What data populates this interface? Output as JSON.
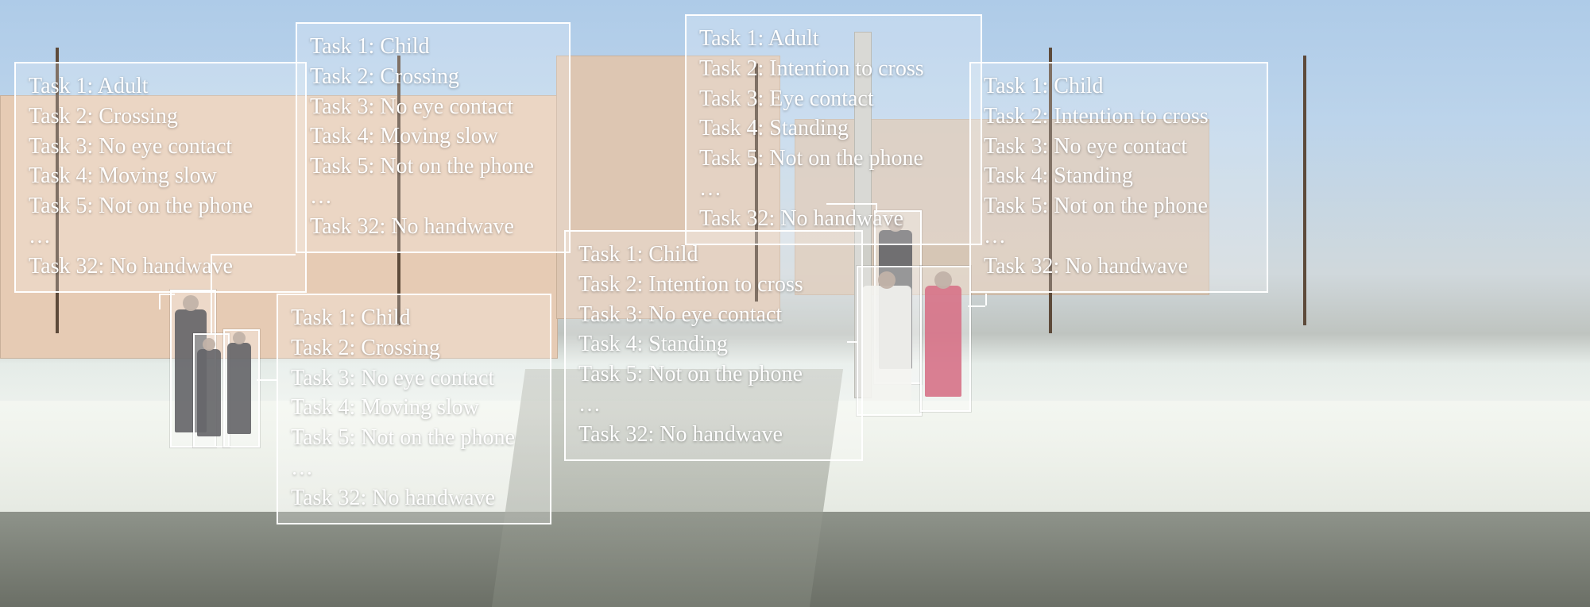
{
  "task_prefix": "Task",
  "ellipsis": "…",
  "panels": {
    "p1": {
      "lines": {
        "t1": "1: Adult",
        "t2": "2: Crossing",
        "t3": "3: No eye contact",
        "t4": "4: Moving slow",
        "t5": "5: Not on the phone",
        "t32": "32: No handwave"
      }
    },
    "p2": {
      "lines": {
        "t1": "1: Child",
        "t2": "2: Crossing",
        "t3": "3: No eye contact",
        "t4": "4: Moving slow",
        "t5": "5: Not on the phone",
        "t32": "32: No handwave"
      }
    },
    "p3": {
      "lines": {
        "t1": "1: Child",
        "t2": "2: Crossing",
        "t3": "3: No eye contact",
        "t4": "4: Moving slow",
        "t5": "5: Not on the phone",
        "t32": "32: No handwave"
      }
    },
    "p4": {
      "lines": {
        "t1": "1: Adult",
        "t2": "2: Intention to cross",
        "t3": "3: Eye contact",
        "t4": "4: Standing",
        "t5": "5: Not on the phone",
        "t32": "32: No handwave"
      }
    },
    "p5": {
      "lines": {
        "t1": "1: Child",
        "t2": "2: Intention to cross",
        "t3": "3: No eye contact",
        "t4": "4: Standing",
        "t5": "5: Not on the phone",
        "t32": "32: No handwave"
      }
    },
    "p6": {
      "lines": {
        "t1": "1: Child",
        "t2": "2: Intention to cross",
        "t3": "3: No eye contact",
        "t4": "4: Standing",
        "t5": "5: Not on the phone",
        "t32": "32: No handwave"
      }
    }
  }
}
